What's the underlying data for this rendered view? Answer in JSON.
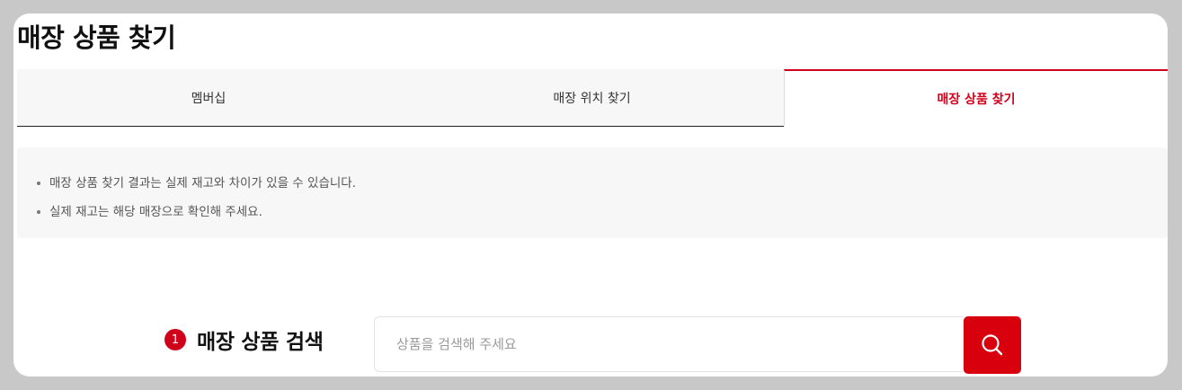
{
  "page": {
    "title": "매장 상품 찾기"
  },
  "tabs": [
    {
      "label": "멤버십",
      "active": false
    },
    {
      "label": "매장 위치 찾기",
      "active": false
    },
    {
      "label": "매장 상품 찾기",
      "active": true
    }
  ],
  "notice": {
    "items": [
      "매장 상품 찾기 결과는 실제 재고와 차이가 있을 수 있습니다.",
      "실제 재고는 해당 매장으로 확인해 주세요."
    ]
  },
  "search": {
    "step": "1",
    "title": "매장 상품 검색",
    "placeholder": "상품을 검색해 주세요",
    "value": "",
    "button_icon": "search-icon"
  },
  "colors": {
    "accent": "#d0021b",
    "button": "#d9000d",
    "notice_bg": "#f7f7f7",
    "page_bg": "#c8c8c8"
  }
}
